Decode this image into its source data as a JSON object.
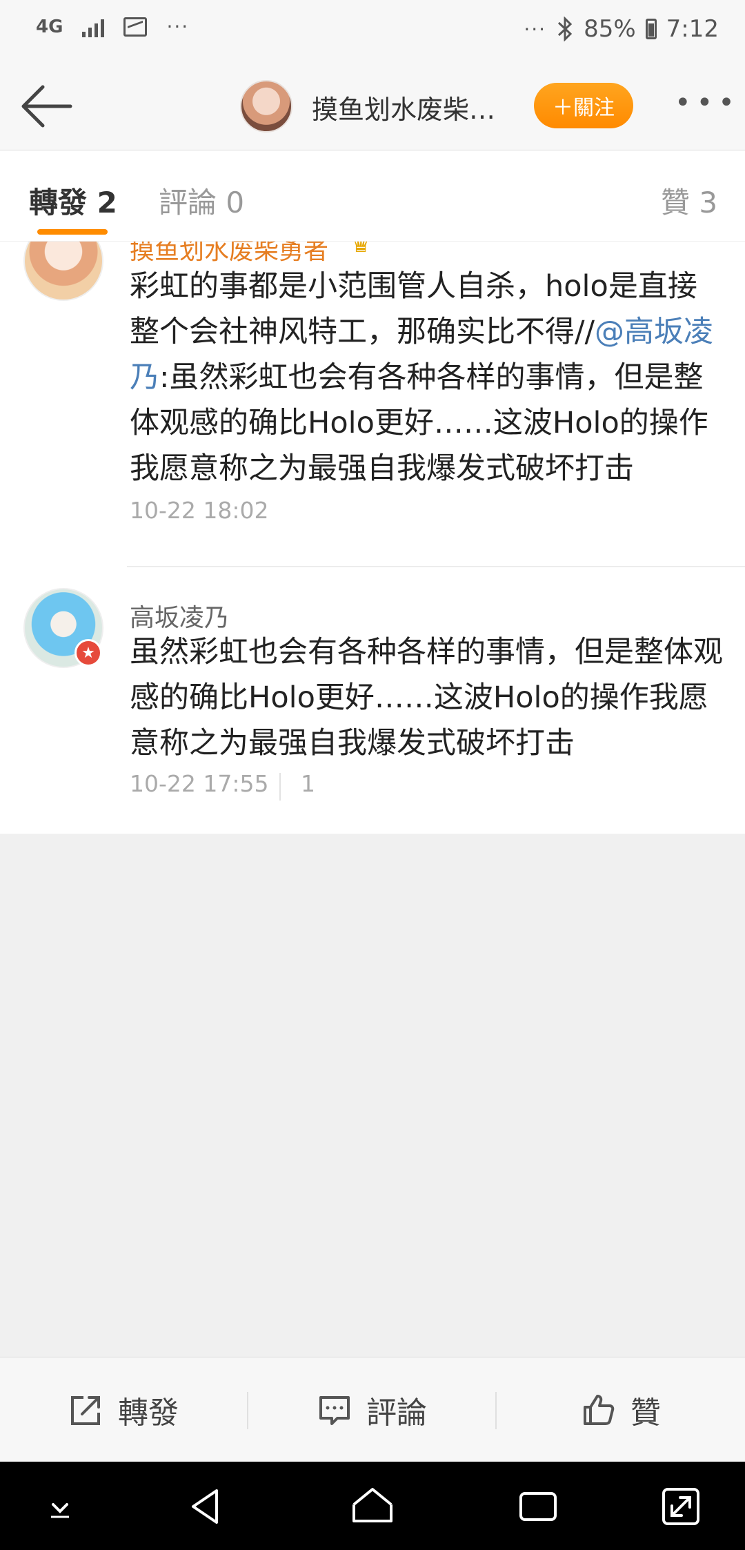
{
  "status_bar": {
    "network": "4G",
    "left_more": "···",
    "right_more": "···",
    "battery": "85%",
    "time": "7:12"
  },
  "nav": {
    "title": "摸鱼划水废柴…",
    "follow_label": "＋關注",
    "more_label": "•••"
  },
  "tabs": [
    {
      "label": "轉發 2"
    },
    {
      "label": "評論 0"
    },
    {
      "label": "贊 3"
    }
  ],
  "reposts": [
    {
      "username": "摸鱼划水废柴勇者",
      "content_before": "彩虹的事都是小范围管人自杀，holo是直接整个会社神风特工，那确实比不得//",
      "mention": "@高坂凌乃",
      "content_after": ":虽然彩虹也会有各种各样的事情，但是整体观感的确比Holo更好……这波Holo的操作我愿意称之为最强自我爆发式破坏打击",
      "time": "10-22 18:02"
    },
    {
      "username": "高坂凌乃",
      "content": "虽然彩虹也会有各种各样的事情，但是整体观感的确比Holo更好……这波Holo的操作我愿意称之为最强自我爆发式破坏打击",
      "time": "10-22 17:55",
      "likes": "1"
    }
  ],
  "actions": {
    "repost_label": "轉發",
    "comment_label": "評論",
    "like_label": "贊"
  },
  "colors": {
    "accent": "#ff8c00",
    "vip_name": "#e67e22",
    "mention": "#4b7fb8"
  }
}
